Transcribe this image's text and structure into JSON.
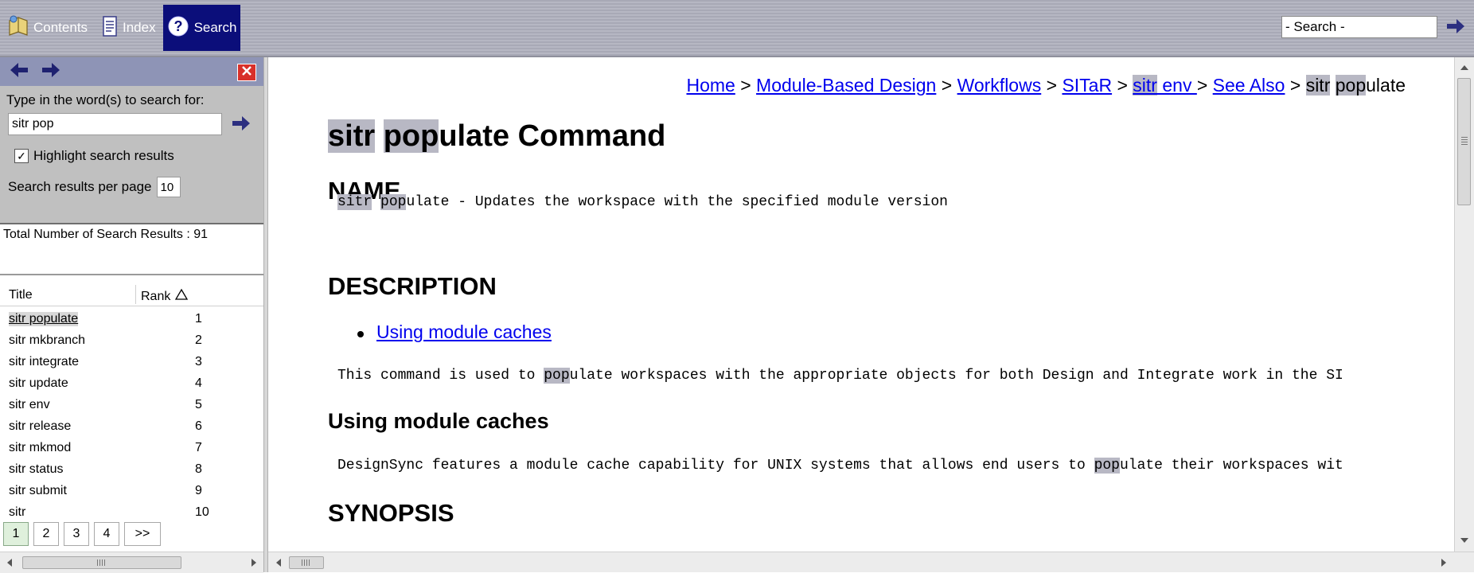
{
  "toolbar": {
    "contents_label": "Contents",
    "index_label": "Index",
    "search_label": "Search",
    "search_field_value": "- Search -"
  },
  "left_panel": {
    "search_prompt": "Type in the word(s) to search for:",
    "search_value": "sitr pop",
    "highlight_label": "Highlight search results",
    "highlight_checked": true,
    "per_page_label": "Search results per page",
    "per_page_value": "10",
    "total_results": "Total Number of Search Results : 91",
    "columns": {
      "title": "Title",
      "rank": "Rank"
    },
    "results": [
      {
        "title": "sitr populate",
        "rank": "1"
      },
      {
        "title": "sitr mkbranch",
        "rank": "2"
      },
      {
        "title": "sitr integrate",
        "rank": "3"
      },
      {
        "title": "sitr update",
        "rank": "4"
      },
      {
        "title": "sitr env",
        "rank": "5"
      },
      {
        "title": "sitr release",
        "rank": "6"
      },
      {
        "title": "sitr mkmod",
        "rank": "7"
      },
      {
        "title": "sitr status",
        "rank": "8"
      },
      {
        "title": "sitr submit",
        "rank": "9"
      },
      {
        "title": "sitr",
        "rank": "10"
      }
    ],
    "pages": [
      "1",
      "2",
      "3",
      "4"
    ],
    "pages_next": ">>"
  },
  "content": {
    "breadcrumb": {
      "home": "Home",
      "sep": ">",
      "module_based_design": "Module-Based Design",
      "workflows": "Workflows",
      "sitar": "SITaR",
      "sitr_env_a": "sitr",
      "sitr_env_b": " env ",
      "see_also": "See Also",
      "current_a": "sitr",
      "current_b": "pop",
      "current_c": "ulate"
    },
    "title": {
      "a": "sitr",
      "b": "pop",
      "c": "ulate Command"
    },
    "name_heading": "NAME",
    "name_text": {
      "a": "sitr",
      "b": "pop",
      "c": "ulate - Updates the workspace with the specified module version"
    },
    "description_heading": "DESCRIPTION",
    "description_link": "Using module caches",
    "description_text": {
      "a": "This command is used to ",
      "b": "pop",
      "c": "ulate workspaces with the appropriate objects for both Design and Integrate work in the SI"
    },
    "module_caches_heading": "Using module caches",
    "module_caches_text": {
      "a": "DesignSync features a module cache capability for UNIX systems that allows end users to ",
      "b": "pop",
      "c": "ulate their workspaces wit"
    },
    "synopsis_heading": "SYNOPSIS"
  },
  "colors": {
    "toolbar_bg": "#b0b1bd",
    "active_tab": "#0b0e7a",
    "nav_bar": "#8e94b6",
    "form_bg": "#c0c0c0",
    "highlight": "#b8b8c4",
    "link": "#0000ee",
    "close_button": "#d8302a"
  }
}
